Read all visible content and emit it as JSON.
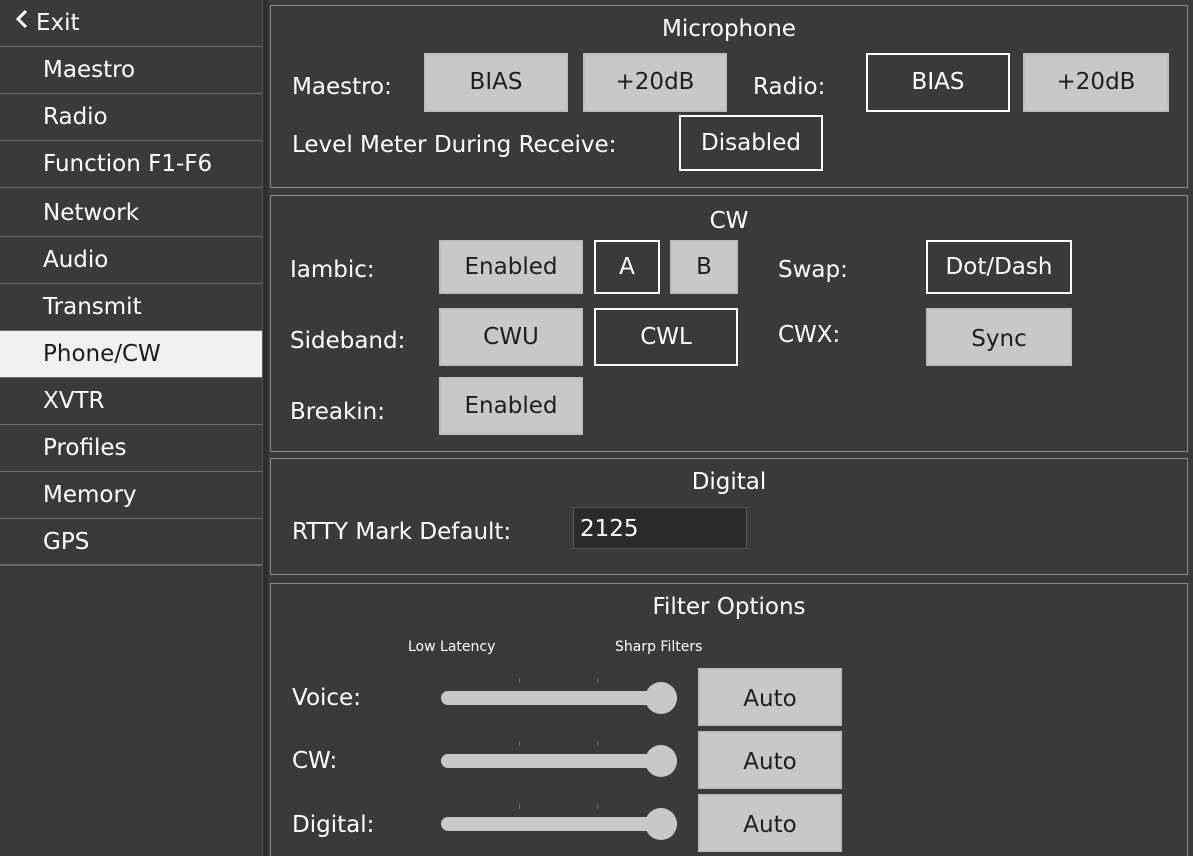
{
  "sidebar": {
    "exit_label": "Exit",
    "items": [
      {
        "label": "Maestro"
      },
      {
        "label": "Radio"
      },
      {
        "label": "Function F1-F6"
      },
      {
        "label": "Network"
      },
      {
        "label": "Audio"
      },
      {
        "label": "Transmit"
      },
      {
        "label": "Phone/CW",
        "active": true
      },
      {
        "label": "XVTR"
      },
      {
        "label": "Profiles"
      },
      {
        "label": "Memory"
      },
      {
        "label": "GPS"
      }
    ]
  },
  "microphone": {
    "title": "Microphone",
    "maestro_label": "Maestro:",
    "maestro_bias": "BIAS",
    "maestro_boost": "+20dB",
    "radio_label": "Radio:",
    "radio_bias": "BIAS",
    "radio_boost": "+20dB",
    "level_meter_label": "Level Meter During Receive:",
    "level_meter_value": "Disabled"
  },
  "cw": {
    "title": "CW",
    "iambic_label": "Iambic:",
    "iambic_value": "Enabled",
    "mode_a": "A",
    "mode_b": "B",
    "swap_label": "Swap:",
    "swap_value": "Dot/Dash",
    "sideband_label": "Sideband:",
    "cwu": "CWU",
    "cwl": "CWL",
    "cwx_label": "CWX:",
    "cwx_value": "Sync",
    "breakin_label": "Breakin:",
    "breakin_value": "Enabled"
  },
  "digital": {
    "title": "Digital",
    "rtty_label": "RTTY Mark Default:",
    "rtty_value": "2125"
  },
  "filter": {
    "title": "Filter Options",
    "low_latency": "Low Latency",
    "sharp_filters": "Sharp Filters",
    "rows": [
      {
        "label": "Voice:",
        "mode": "Auto",
        "level": 1.0
      },
      {
        "label": "CW:",
        "mode": "Auto",
        "level": 1.0
      },
      {
        "label": "Digital:",
        "mode": "Auto",
        "level": 1.0
      }
    ]
  },
  "colors": {
    "background": "#3a3a3a",
    "button_on": "#c8c8c8",
    "active_item": "#f0f0f0",
    "text": "#ffffff"
  }
}
